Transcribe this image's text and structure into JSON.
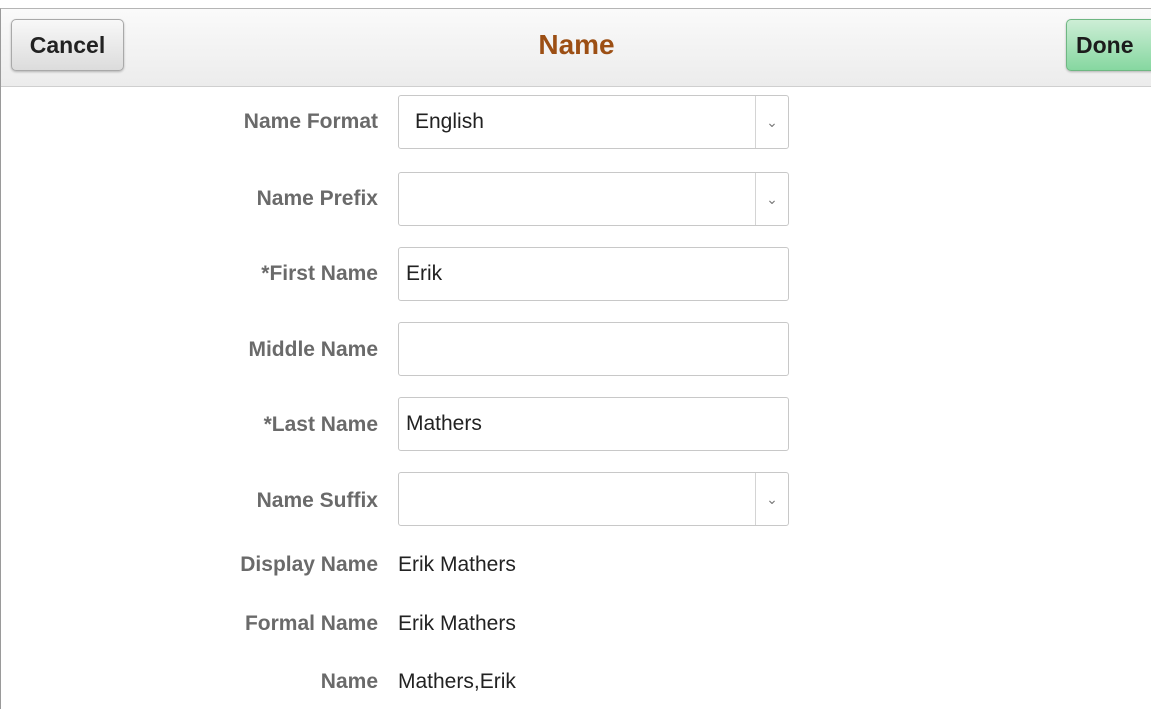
{
  "header": {
    "title": "Name",
    "cancel_label": "Cancel",
    "done_label": "Done"
  },
  "form": {
    "name_format": {
      "label": "Name Format",
      "value": "English"
    },
    "name_prefix": {
      "label": "Name Prefix",
      "value": ""
    },
    "first_name": {
      "label": "*First Name",
      "value": "Erik"
    },
    "middle_name": {
      "label": "Middle Name",
      "value": ""
    },
    "last_name": {
      "label": "*Last Name",
      "value": "Mathers"
    },
    "name_suffix": {
      "label": "Name Suffix",
      "value": ""
    },
    "display_name": {
      "label": "Display Name",
      "value": "Erik Mathers"
    },
    "formal_name": {
      "label": "Formal Name",
      "value": "Erik Mathers"
    },
    "name": {
      "label": "Name",
      "value": "Mathers,Erik"
    }
  },
  "colors": {
    "title": "#9c4f14",
    "done_button": "#86d7a0",
    "label_text": "#6a6a6a"
  },
  "icons": {
    "dropdown": "chevron-down-icon"
  }
}
